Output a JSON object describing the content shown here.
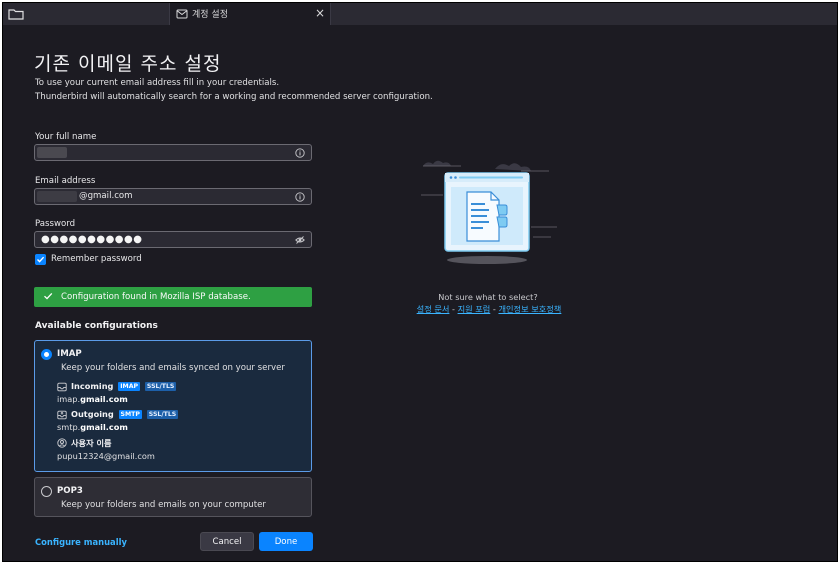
{
  "tab": {
    "label": "계정 설정",
    "close": "×"
  },
  "page": {
    "title": "기존 이메일 주소 설정",
    "subtitle_1": "To use your current email address fill in your credentials.",
    "subtitle_2": "Thunderbird will automatically search for a working and recommended server configuration."
  },
  "form": {
    "full_name_label": "Your full name",
    "full_name_value": "",
    "email_label": "Email address",
    "email_value": "@gmail.com",
    "password_label": "Password",
    "password_value": "●●●●●●●●●●●",
    "remember_label": "Remember password",
    "remember_checked": true
  },
  "status": {
    "message": "Configuration found in Mozilla ISP database.",
    "color": "#2ea043"
  },
  "configs": {
    "heading": "Available configurations",
    "imap": {
      "name": "IMAP",
      "description": "Keep your folders and emails synced on your server",
      "incoming_label": "Incoming",
      "incoming_protocol": "IMAP",
      "incoming_security": "SSL/TLS",
      "incoming_host_prefix": "imap.",
      "incoming_host_domain": "gmail.com",
      "outgoing_label": "Outgoing",
      "outgoing_protocol": "SMTP",
      "outgoing_security": "SSL/TLS",
      "outgoing_host_prefix": "smtp.",
      "outgoing_host_domain": "gmail.com",
      "username_label": "사용자 이름",
      "username_value": "pupu12324@gmail.com"
    },
    "pop3": {
      "name": "POP3",
      "description": "Keep your folders and emails on your computer"
    }
  },
  "actions": {
    "configure_manually": "Configure manually",
    "cancel": "Cancel",
    "done": "Done"
  },
  "help": {
    "question": "Not sure what to select?",
    "link_docs": "설정 문서",
    "link_forum": "지원 포럼",
    "link_privacy": "개인정보 보호정책",
    "sep": " - "
  },
  "colors": {
    "accent": "#0a84ff",
    "link": "#3ab4ff",
    "background": "#1c1b22"
  }
}
